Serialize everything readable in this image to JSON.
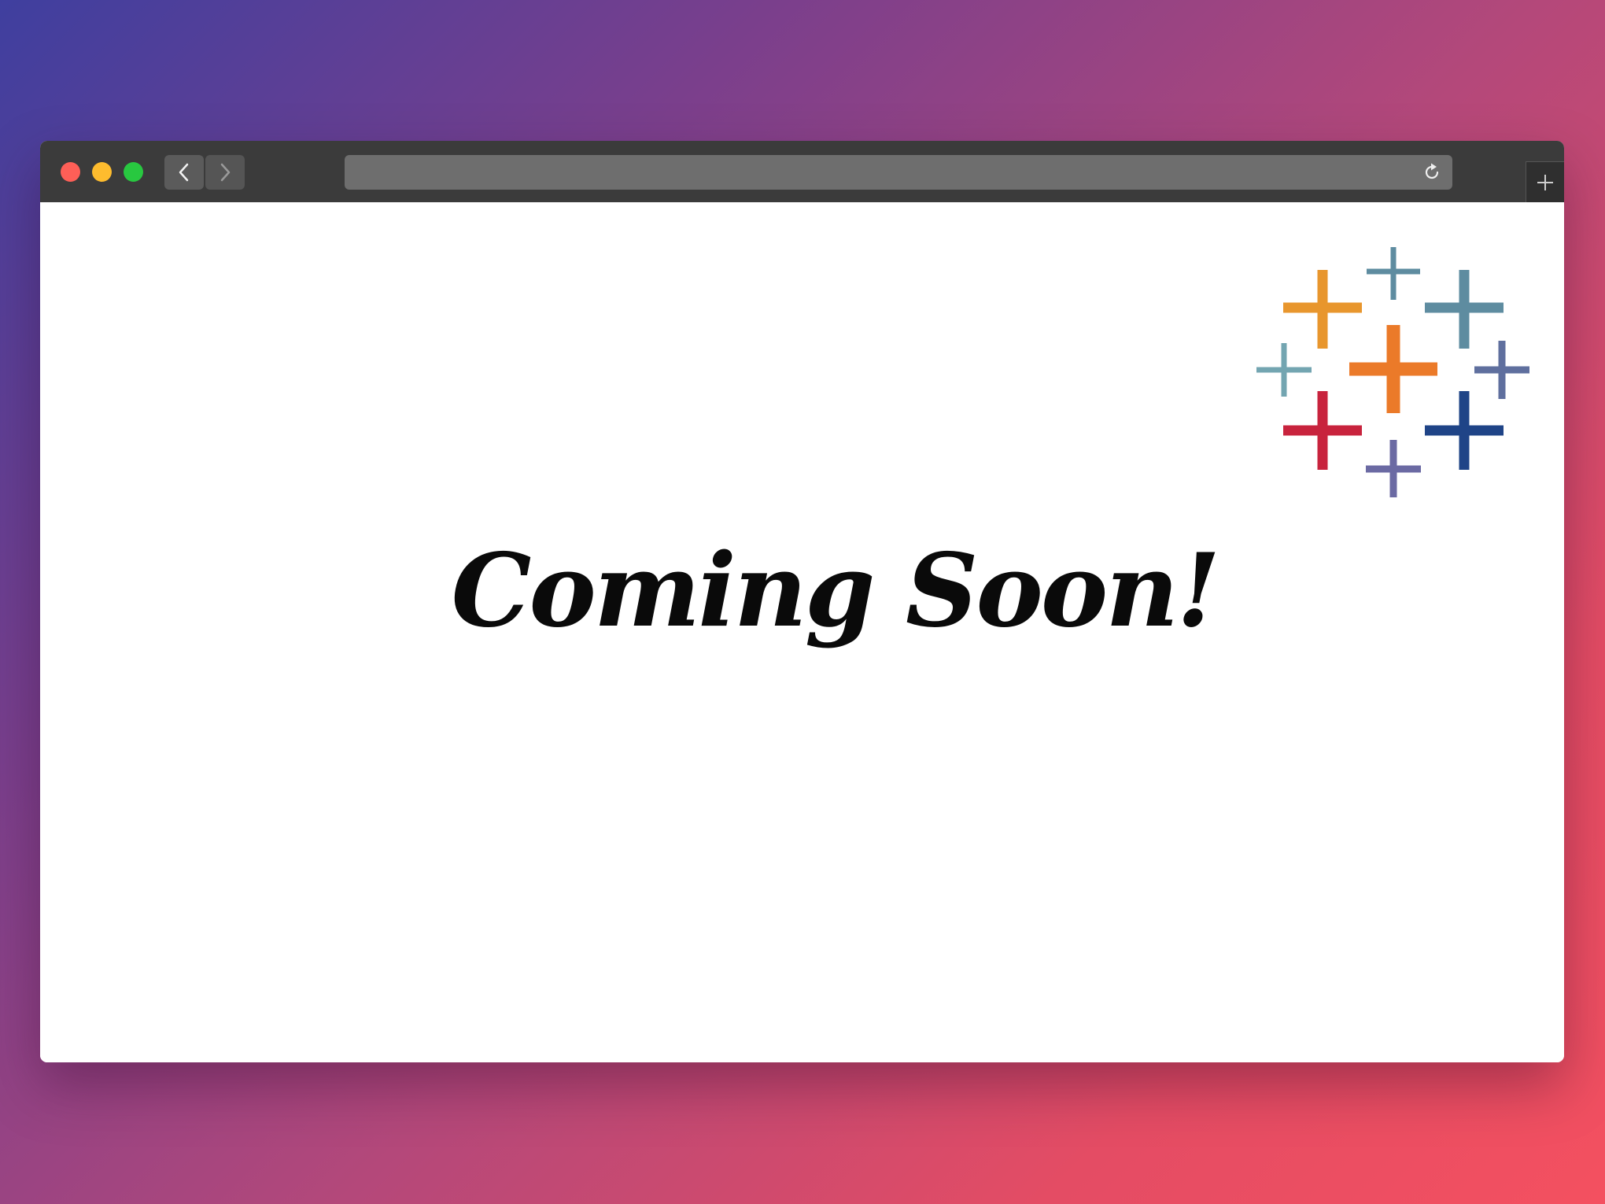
{
  "browser": {
    "controls": {
      "close": "close-window",
      "minimize": "minimize-window",
      "zoom": "zoom-window"
    },
    "icons": {
      "back": "chevron-left-icon",
      "forward": "chevron-right-icon",
      "reload": "reload-icon",
      "new_tab": "plus-icon"
    },
    "address": "",
    "colors": {
      "titlebar": "#3b3b3b",
      "address_bar": "#6e6e6e",
      "close": "#fe5f57",
      "minimize": "#febc2e",
      "zoom": "#28c840"
    }
  },
  "page": {
    "headline": "Coming Soon!",
    "logo": {
      "name": "tableau-logo",
      "colors": [
        "#e8962d",
        "#5e8ca0",
        "#eb7a29",
        "#5f6f9e",
        "#c8233d",
        "#1f4487",
        "#6b6aa3",
        "#73a5b1"
      ]
    }
  }
}
